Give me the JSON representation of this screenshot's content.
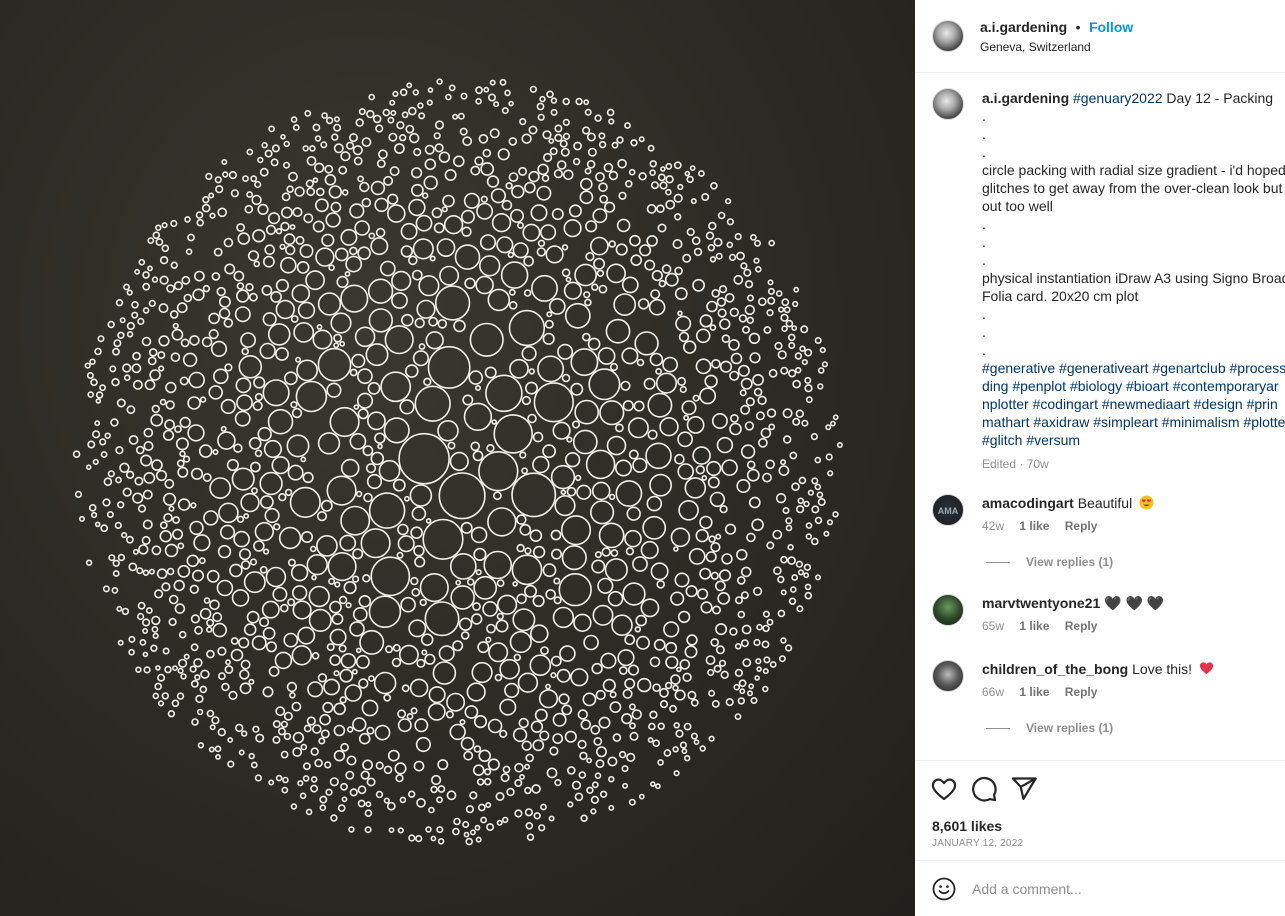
{
  "post": {
    "media_alt": "circle packing plot",
    "author": "a.i.gardening",
    "separator": "•",
    "follow_label": "Follow",
    "location": "Geneva, Switzerland"
  },
  "caption": {
    "author": "a.i.gardening",
    "first_hashtag": "#genuary2022",
    "first_text": " Day 12 - Packing",
    "dots": ".",
    "para1": [
      "circle packing with radial size gradient - i'd hoped",
      "glitches to get away from the over-clean look but",
      "out too well"
    ],
    "para2": [
      "physical instantiation iDraw A3 using Signo Broad",
      "Folia card. 20x20 cm plot"
    ],
    "hashtags": [
      "#generative #generativeart #genartclub #process",
      "ding #penplot #biology #bioart #contemporaryar",
      "nplotter #codingart #newmediaart #design #prin",
      "mathart #axidraw #simpleart #minimalism #plotte",
      "#glitch #versum"
    ],
    "edited": "Edited · 70w"
  },
  "comments": [
    {
      "user": "amacodingart",
      "text": "Beautiful",
      "emoji": "heart-eyes-emoji",
      "time": "42w",
      "likes": "1 like",
      "reply": "Reply",
      "view_replies": "View replies (1)"
    },
    {
      "user": "marvtwentyone21",
      "text": "🖤 🖤 🖤",
      "emoji": "black-hearts",
      "time": "65w",
      "likes": "1 like",
      "reply": "Reply"
    },
    {
      "user": "children_of_the_bong",
      "text": "Love this!",
      "emoji": "red-heart-emoji",
      "time": "66w",
      "likes": "1 like",
      "reply": "Reply",
      "view_replies": "View replies (1)"
    }
  ],
  "actions": {
    "like_icon": "heart-icon",
    "comment_icon": "comment-icon",
    "share_icon": "share-icon",
    "likes": "8,601 likes",
    "date": "JANUARY 12, 2022"
  },
  "add_comment": {
    "placeholder": "Add a comment...",
    "icon": "smile-icon"
  },
  "colors": {
    "link": "#0095f6",
    "hashtag": "#00376b",
    "muted": "#8e8e8e",
    "media_bg": "#2c2a24"
  }
}
